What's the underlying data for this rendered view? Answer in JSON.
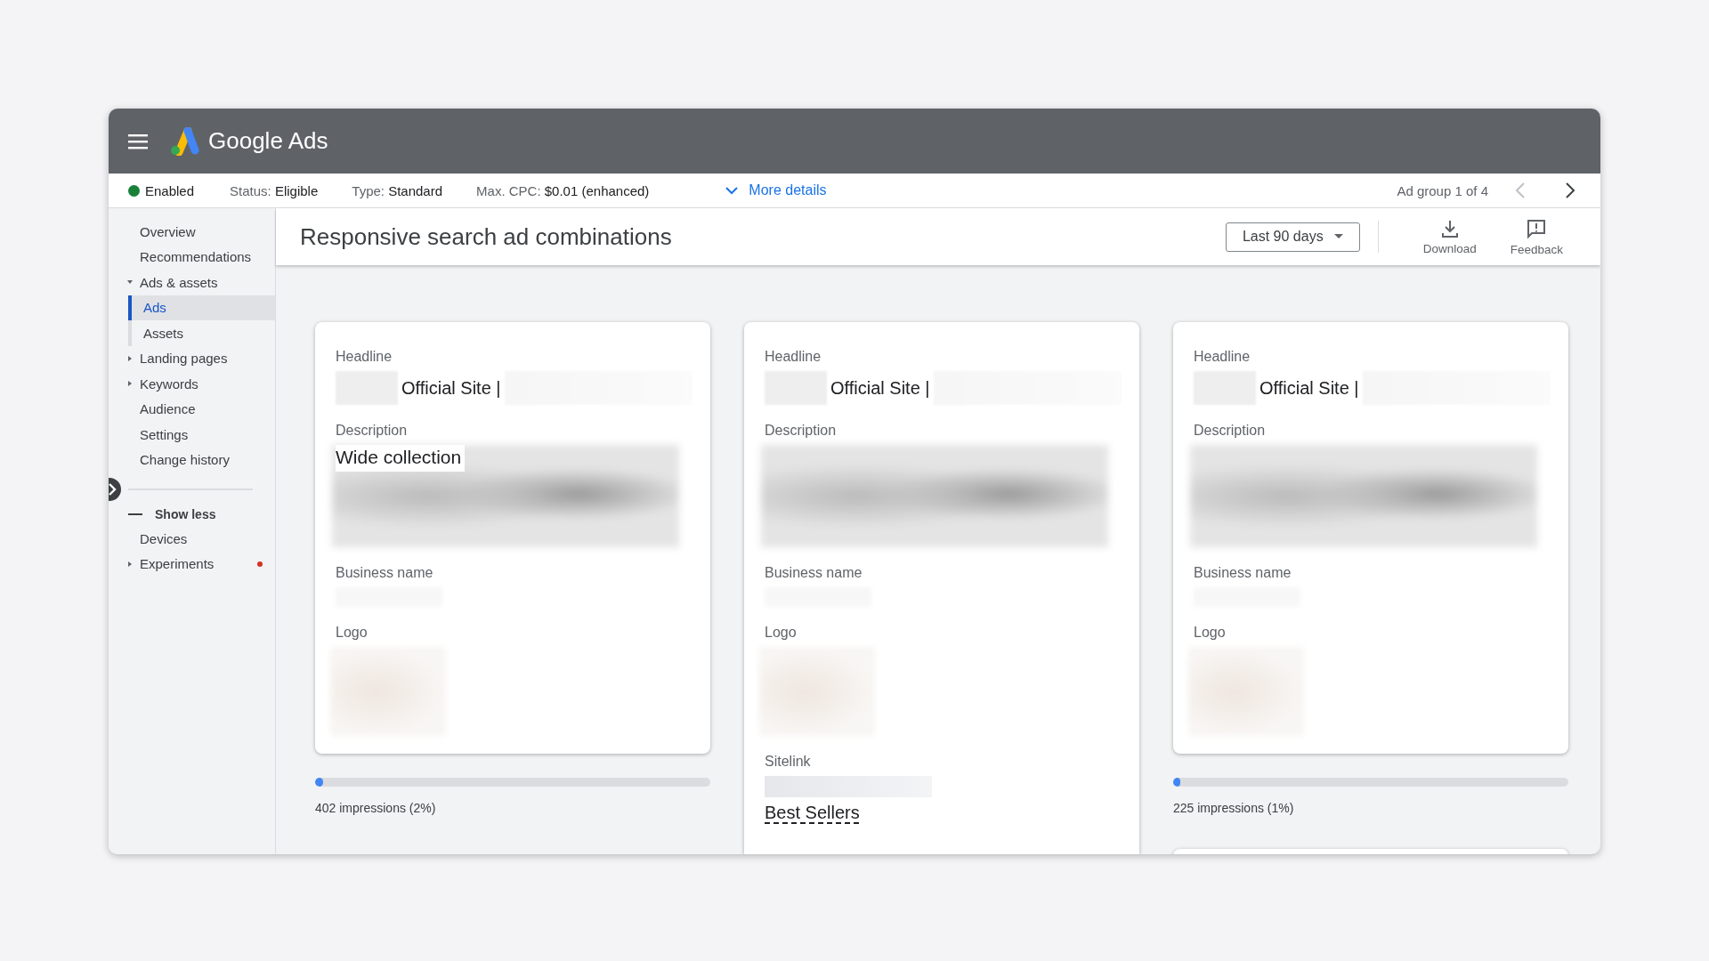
{
  "header": {
    "title": "Google Ads"
  },
  "info_bar": {
    "status": {
      "label": "Enabled",
      "color": "#188038"
    },
    "fields": [
      {
        "label": "Status:",
        "value": "Eligible"
      },
      {
        "label": "Type:",
        "value": "Standard"
      },
      {
        "label": "Max. CPC:",
        "value": "$0.01 (enhanced)"
      }
    ],
    "more_details": "More details",
    "ad_group": "Ad group 1 of 4",
    "prev_disabled": true,
    "next_disabled": false
  },
  "sidebar": {
    "items": [
      {
        "kind": "link",
        "label": "Overview",
        "selected": false
      },
      {
        "kind": "link",
        "label": "Recommendations",
        "selected": false
      },
      {
        "kind": "group",
        "label": "Ads & assets",
        "expanded": true,
        "children": [
          {
            "kind": "link",
            "label": "Ads",
            "selected": true
          },
          {
            "kind": "link",
            "label": "Assets",
            "selected": false
          }
        ]
      },
      {
        "kind": "group",
        "label": "Landing pages",
        "expanded": false
      },
      {
        "kind": "group",
        "label": "Keywords",
        "expanded": false
      },
      {
        "kind": "link",
        "label": "Audience",
        "selected": false
      },
      {
        "kind": "link",
        "label": "Settings",
        "selected": false
      },
      {
        "kind": "link",
        "label": "Change history",
        "selected": false
      },
      {
        "kind": "toggle",
        "label": "Show less"
      },
      {
        "kind": "link",
        "label": "Devices",
        "selected": false
      },
      {
        "kind": "group",
        "label": "Experiments",
        "expanded": false,
        "alert": true
      }
    ]
  },
  "page": {
    "title": "Responsive search ad combinations",
    "date_range": "Last 90 days",
    "actions": [
      {
        "kind": "download",
        "label": "Download"
      },
      {
        "kind": "feedback",
        "label": "Feedback"
      }
    ]
  },
  "columns": [
    {
      "cards": [
        {
          "kind": "ad",
          "fields": [
            {
              "kind": "headline",
              "label": "Headline",
              "value": "Official Site |"
            },
            {
              "kind": "description",
              "label": "Description",
              "value": "Wide collection"
            },
            {
              "kind": "business",
              "label": "Business name"
            },
            {
              "kind": "logo",
              "label": "Logo"
            }
          ],
          "impressions": {
            "level": 0.02,
            "text": "402 impressions (2%)"
          }
        }
      ]
    },
    {
      "cards": [
        {
          "kind": "ad",
          "fields": [
            {
              "kind": "headline",
              "label": "Headline",
              "value": "Official Site |"
            },
            {
              "kind": "description",
              "label": "Description"
            },
            {
              "kind": "business",
              "label": "Business name"
            },
            {
              "kind": "logo",
              "label": "Logo"
            },
            {
              "kind": "sitelink",
              "label": "Sitelink",
              "value": "Best Sellers"
            }
          ]
        }
      ]
    },
    {
      "cards": [
        {
          "kind": "ad",
          "fields": [
            {
              "kind": "headline",
              "label": "Headline",
              "value": "Official Site |"
            },
            {
              "kind": "description",
              "label": "Description"
            },
            {
              "kind": "business",
              "label": "Business name"
            },
            {
              "kind": "logo",
              "label": "Logo"
            }
          ],
          "impressions": {
            "level": 0.01,
            "text": "225 impressions (1%)"
          }
        },
        {
          "kind": "empty"
        }
      ]
    }
  ]
}
